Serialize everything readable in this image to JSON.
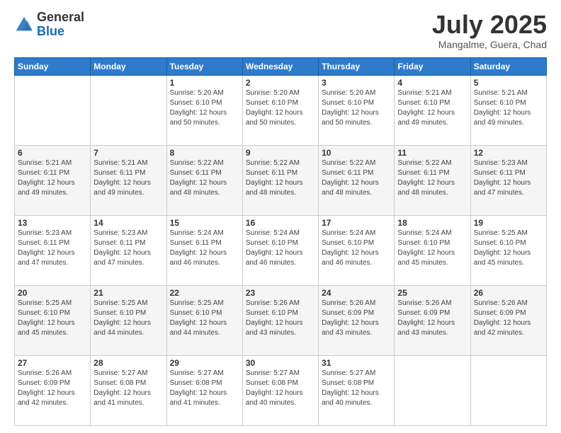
{
  "header": {
    "logo_general": "General",
    "logo_blue": "Blue",
    "month_title": "July 2025",
    "subtitle": "Mangalme, Guera, Chad"
  },
  "days_of_week": [
    "Sunday",
    "Monday",
    "Tuesday",
    "Wednesday",
    "Thursday",
    "Friday",
    "Saturday"
  ],
  "weeks": [
    [
      {
        "day": "",
        "info": ""
      },
      {
        "day": "",
        "info": ""
      },
      {
        "day": "1",
        "info": "Sunrise: 5:20 AM\nSunset: 6:10 PM\nDaylight: 12 hours and 50 minutes."
      },
      {
        "day": "2",
        "info": "Sunrise: 5:20 AM\nSunset: 6:10 PM\nDaylight: 12 hours and 50 minutes."
      },
      {
        "day": "3",
        "info": "Sunrise: 5:20 AM\nSunset: 6:10 PM\nDaylight: 12 hours and 50 minutes."
      },
      {
        "day": "4",
        "info": "Sunrise: 5:21 AM\nSunset: 6:10 PM\nDaylight: 12 hours and 49 minutes."
      },
      {
        "day": "5",
        "info": "Sunrise: 5:21 AM\nSunset: 6:10 PM\nDaylight: 12 hours and 49 minutes."
      }
    ],
    [
      {
        "day": "6",
        "info": "Sunrise: 5:21 AM\nSunset: 6:11 PM\nDaylight: 12 hours and 49 minutes."
      },
      {
        "day": "7",
        "info": "Sunrise: 5:21 AM\nSunset: 6:11 PM\nDaylight: 12 hours and 49 minutes."
      },
      {
        "day": "8",
        "info": "Sunrise: 5:22 AM\nSunset: 6:11 PM\nDaylight: 12 hours and 48 minutes."
      },
      {
        "day": "9",
        "info": "Sunrise: 5:22 AM\nSunset: 6:11 PM\nDaylight: 12 hours and 48 minutes."
      },
      {
        "day": "10",
        "info": "Sunrise: 5:22 AM\nSunset: 6:11 PM\nDaylight: 12 hours and 48 minutes."
      },
      {
        "day": "11",
        "info": "Sunrise: 5:22 AM\nSunset: 6:11 PM\nDaylight: 12 hours and 48 minutes."
      },
      {
        "day": "12",
        "info": "Sunrise: 5:23 AM\nSunset: 6:11 PM\nDaylight: 12 hours and 47 minutes."
      }
    ],
    [
      {
        "day": "13",
        "info": "Sunrise: 5:23 AM\nSunset: 6:11 PM\nDaylight: 12 hours and 47 minutes."
      },
      {
        "day": "14",
        "info": "Sunrise: 5:23 AM\nSunset: 6:11 PM\nDaylight: 12 hours and 47 minutes."
      },
      {
        "day": "15",
        "info": "Sunrise: 5:24 AM\nSunset: 6:11 PM\nDaylight: 12 hours and 46 minutes."
      },
      {
        "day": "16",
        "info": "Sunrise: 5:24 AM\nSunset: 6:10 PM\nDaylight: 12 hours and 46 minutes."
      },
      {
        "day": "17",
        "info": "Sunrise: 5:24 AM\nSunset: 6:10 PM\nDaylight: 12 hours and 46 minutes."
      },
      {
        "day": "18",
        "info": "Sunrise: 5:24 AM\nSunset: 6:10 PM\nDaylight: 12 hours and 45 minutes."
      },
      {
        "day": "19",
        "info": "Sunrise: 5:25 AM\nSunset: 6:10 PM\nDaylight: 12 hours and 45 minutes."
      }
    ],
    [
      {
        "day": "20",
        "info": "Sunrise: 5:25 AM\nSunset: 6:10 PM\nDaylight: 12 hours and 45 minutes."
      },
      {
        "day": "21",
        "info": "Sunrise: 5:25 AM\nSunset: 6:10 PM\nDaylight: 12 hours and 44 minutes."
      },
      {
        "day": "22",
        "info": "Sunrise: 5:25 AM\nSunset: 6:10 PM\nDaylight: 12 hours and 44 minutes."
      },
      {
        "day": "23",
        "info": "Sunrise: 5:26 AM\nSunset: 6:10 PM\nDaylight: 12 hours and 43 minutes."
      },
      {
        "day": "24",
        "info": "Sunrise: 5:26 AM\nSunset: 6:09 PM\nDaylight: 12 hours and 43 minutes."
      },
      {
        "day": "25",
        "info": "Sunrise: 5:26 AM\nSunset: 6:09 PM\nDaylight: 12 hours and 43 minutes."
      },
      {
        "day": "26",
        "info": "Sunrise: 5:26 AM\nSunset: 6:09 PM\nDaylight: 12 hours and 42 minutes."
      }
    ],
    [
      {
        "day": "27",
        "info": "Sunrise: 5:26 AM\nSunset: 6:09 PM\nDaylight: 12 hours and 42 minutes."
      },
      {
        "day": "28",
        "info": "Sunrise: 5:27 AM\nSunset: 6:08 PM\nDaylight: 12 hours and 41 minutes."
      },
      {
        "day": "29",
        "info": "Sunrise: 5:27 AM\nSunset: 6:08 PM\nDaylight: 12 hours and 41 minutes."
      },
      {
        "day": "30",
        "info": "Sunrise: 5:27 AM\nSunset: 6:08 PM\nDaylight: 12 hours and 40 minutes."
      },
      {
        "day": "31",
        "info": "Sunrise: 5:27 AM\nSunset: 6:08 PM\nDaylight: 12 hours and 40 minutes."
      },
      {
        "day": "",
        "info": ""
      },
      {
        "day": "",
        "info": ""
      }
    ]
  ]
}
